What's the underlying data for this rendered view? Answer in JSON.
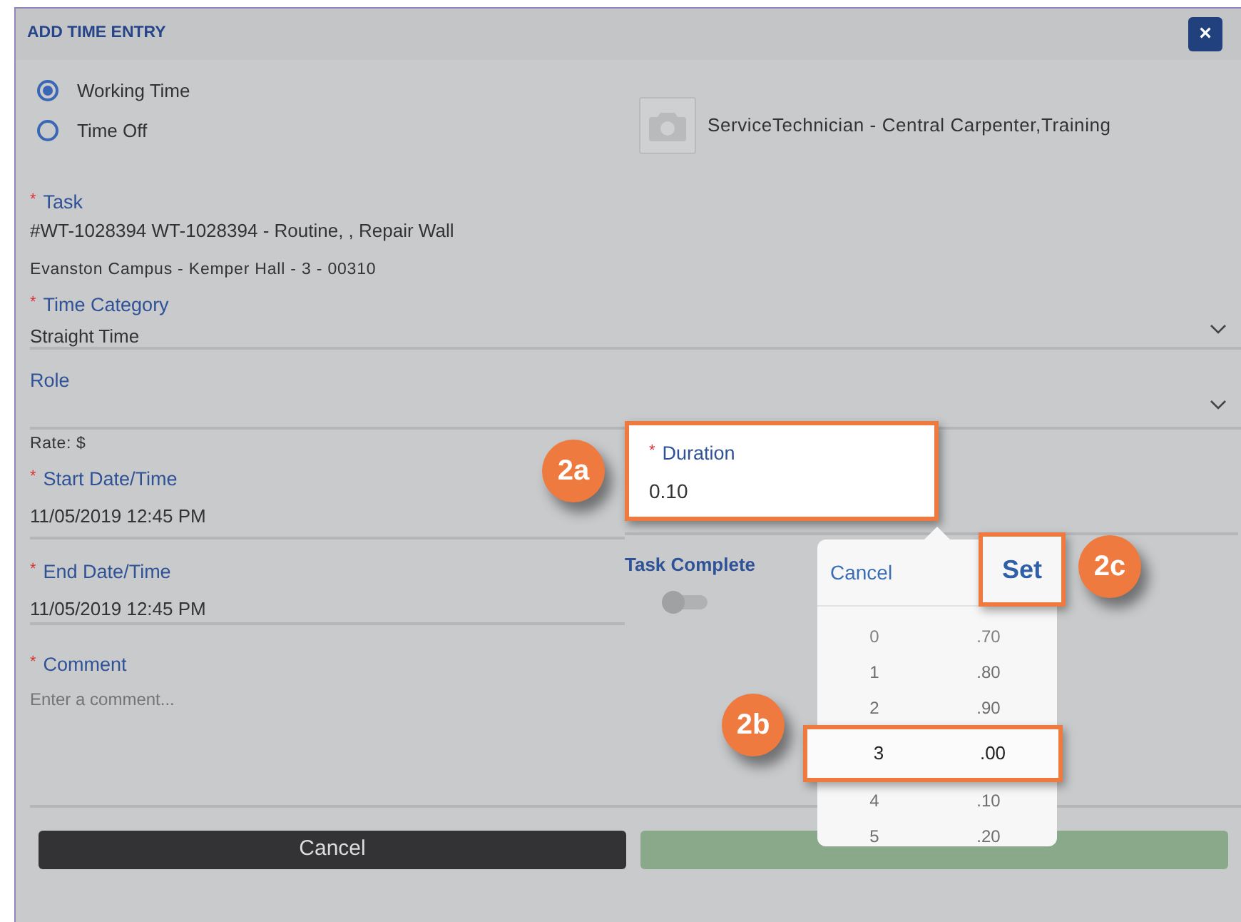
{
  "dialog": {
    "title": "ADD TIME ENTRY",
    "close": "×"
  },
  "time_types": [
    {
      "label": "Working Time",
      "selected": true
    },
    {
      "label": "Time Off",
      "selected": false
    }
  ],
  "technician": "ServiceTechnician - Central Carpenter,Training",
  "task": {
    "mark": "*",
    "label": "Task",
    "value": "#WT-1028394 WT-1028394 - Routine, , Repair Wall",
    "location": "Evanston Campus - Kemper Hall - 3 - 00310"
  },
  "time_category": {
    "mark": "*",
    "label": "Time Category",
    "value": "Straight Time"
  },
  "role": {
    "label": "Role"
  },
  "rate": "Rate: $",
  "start": {
    "mark": "*",
    "label": "Start Date/Time",
    "value": "11/05/2019 12:45 PM"
  },
  "end": {
    "mark": "*",
    "label": "End Date/Time",
    "value": "11/05/2019 12:45 PM"
  },
  "comment": {
    "mark": "*",
    "label": "Comment",
    "placeholder": "Enter a comment..."
  },
  "duration": {
    "mark": "*",
    "label": "Duration",
    "value": "0.10"
  },
  "task_complete": {
    "label": "Task Complete",
    "on": false
  },
  "buttons": {
    "cancel": "Cancel"
  },
  "picker": {
    "cancel": "Cancel",
    "set": "Set",
    "rows": [
      {
        "hours": "0",
        "minutes": ".70",
        "selected": false
      },
      {
        "hours": "1",
        "minutes": ".80",
        "selected": false
      },
      {
        "hours": "2",
        "minutes": ".90",
        "selected": false
      },
      {
        "hours": "3",
        "minutes": ".00",
        "selected": true
      },
      {
        "hours": "4",
        "minutes": ".10",
        "selected": false
      },
      {
        "hours": "5",
        "minutes": ".20",
        "selected": false
      }
    ]
  },
  "callouts": [
    {
      "label": "2a"
    },
    {
      "label": "2b"
    },
    {
      "label": "2c"
    }
  ]
}
